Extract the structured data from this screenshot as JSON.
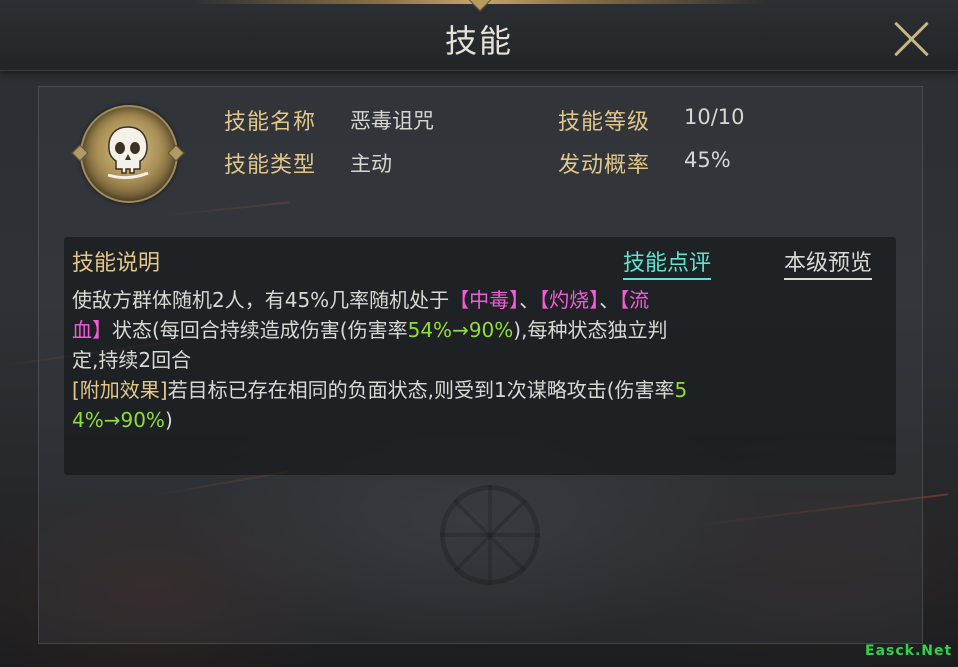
{
  "title": "技能",
  "skill": {
    "icon": "skull-icon",
    "name_label": "技能名称",
    "name_value": "恶毒诅咒",
    "level_label": "技能等级",
    "level_value": "10/10",
    "type_label": "技能类型",
    "type_value": "主动",
    "rate_label": "发动概率",
    "rate_value": "45%"
  },
  "description": {
    "title": "技能说明",
    "review_link": "技能点评",
    "preview_link": "本级预览",
    "line1_a": "使敌方群体随机2人，有45%几率随机处于",
    "status1": "【中毒】",
    "sep1": "、",
    "status2": "【灼烧】",
    "sep2": "、",
    "status3_a": "【流",
    "status3_b": "血】",
    "line2_a": "状态(每回合持续造成伤害(伤害率",
    "rate1": "54%→90%",
    "line2_b": "),每种状态独立判",
    "line3": "定,持续2回合",
    "extra_label": "[附加效果]",
    "extra_text": "若目标已存在相同的负面状态,则受到1次谋略攻击(伤害率",
    "rate2_a": "5",
    "rate2_b": "4%→90%",
    "extra_end": ")"
  },
  "watermark": "Easck.Net"
}
